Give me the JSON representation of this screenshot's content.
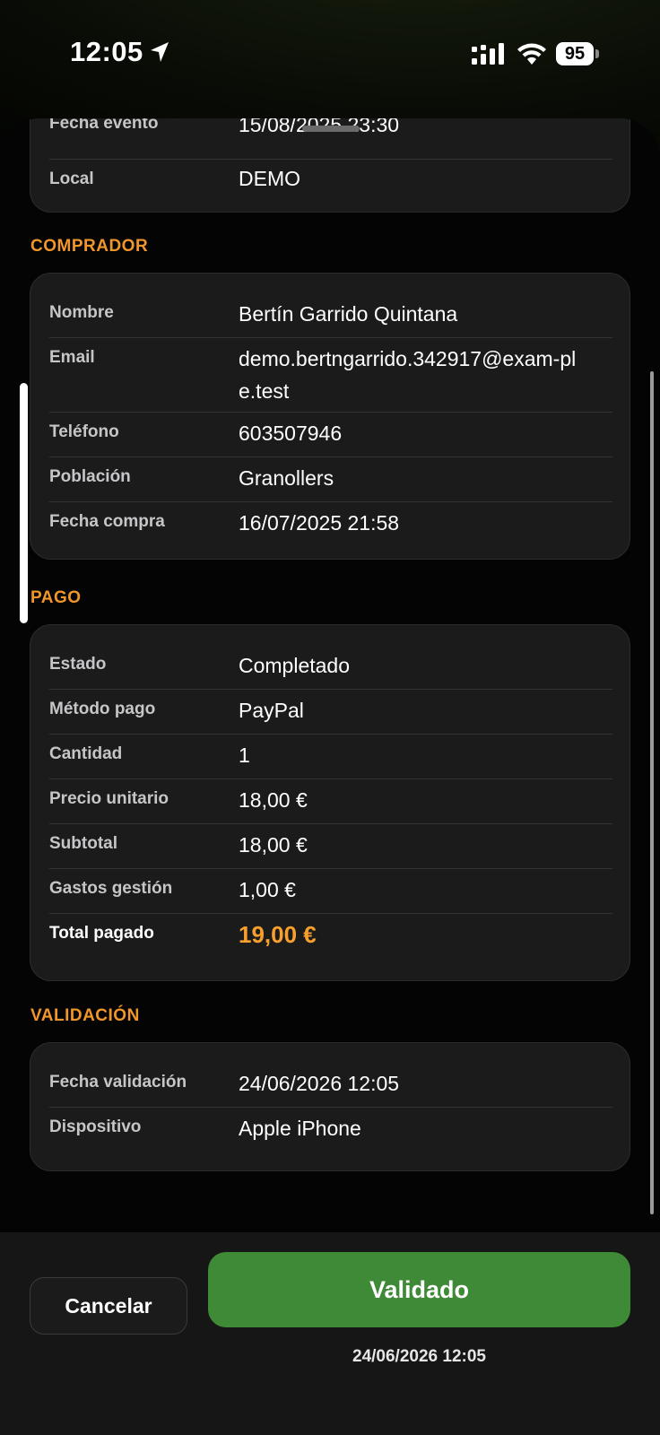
{
  "status_bar": {
    "time": "12:05",
    "battery": "95"
  },
  "event": {
    "rows": [
      {
        "label": "Fecha evento",
        "value": "15/08/2025 23:30"
      },
      {
        "label": "Local",
        "value": "DEMO"
      }
    ]
  },
  "buyer": {
    "title": "COMPRADOR",
    "rows": [
      {
        "label": "Nombre",
        "value": "Bertín Garrido Quintana"
      },
      {
        "label": "Email",
        "value": "demo.bertngarrido.342917@exam-ple.test"
      },
      {
        "label": "Teléfono",
        "value": "603507946"
      },
      {
        "label": "Población",
        "value": "Granollers"
      },
      {
        "label": "Fecha compra",
        "value": "16/07/2025 21:58"
      }
    ]
  },
  "payment": {
    "title": "PAGO",
    "rows": [
      {
        "label": "Estado",
        "value": "Completado"
      },
      {
        "label": "Método pago",
        "value": "PayPal"
      },
      {
        "label": "Cantidad",
        "value": "1"
      },
      {
        "label": "Precio unitario",
        "value": "18,00 €"
      },
      {
        "label": "Subtotal",
        "value": "18,00 €"
      },
      {
        "label": "Gastos gestión",
        "value": "1,00 €"
      },
      {
        "label": "Total pagado",
        "value": "19,00 €"
      }
    ]
  },
  "validation": {
    "title": "VALIDACIÓN",
    "rows": [
      {
        "label": "Fecha validación",
        "value": "24/06/2026 12:05"
      },
      {
        "label": "Dispositivo",
        "value": "Apple iPhone"
      }
    ]
  },
  "actions": {
    "cancel_label": "Cancelar",
    "validate_label": "Validado",
    "validated_at": "24/06/2026 12:05"
  },
  "colors": {
    "accent": "#f0962a",
    "success": "#3f8a36",
    "card": "#1b1b1c"
  }
}
